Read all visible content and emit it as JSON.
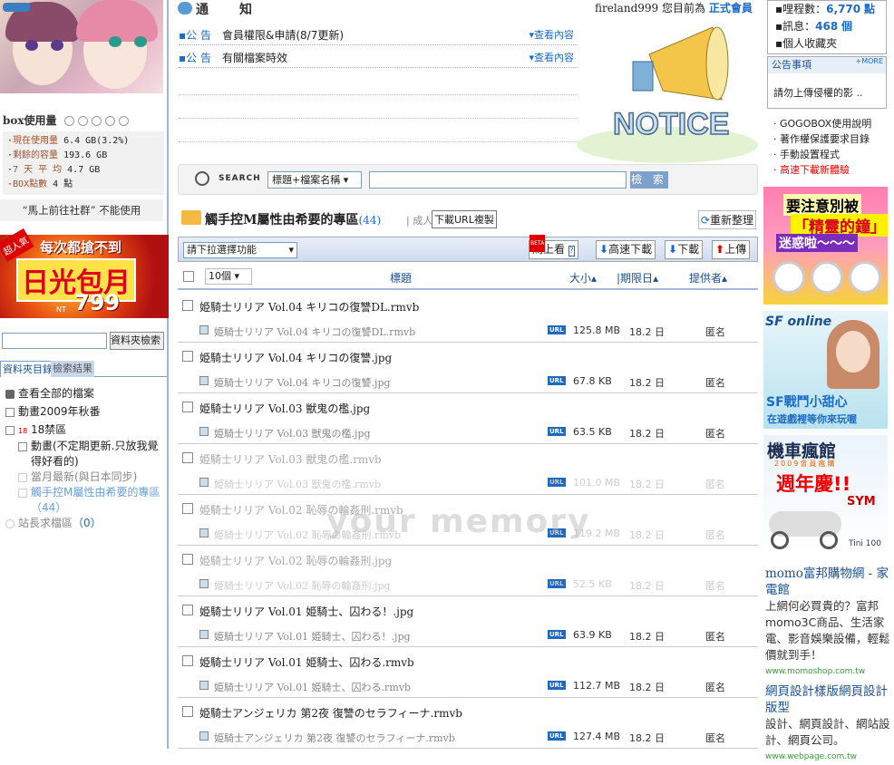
{
  "left": {
    "box_title": "box使用量",
    "box_stats": [
      {
        "k": "現在使用量",
        "v": "6.4 GB(3.2%)"
      },
      {
        "k": "剩餘的容量",
        "v": "193.6 GB"
      },
      {
        "k": "7 天 平 均",
        "v": "4.7 GB"
      },
      {
        "k": "BOX點數",
        "v": "4 點"
      }
    ],
    "go_community": "“馬上前往社群” 不能使用",
    "ad": {
      "tag": "超人氣",
      "line1": "每次都搶不到",
      "line2": "日光包月",
      "price": "799",
      "nt": "NT"
    },
    "folder_search_button": "資料夾檢索",
    "tabs": {
      "folders": "資料夾目錄",
      "results": "檢索結果"
    },
    "tree": {
      "all": "查看全部的檔案",
      "anime2009": "動畫2009年秋番",
      "r18": "18禁區",
      "anime_irregular": "動畫(不定期更新.只放我覺得好看的)",
      "monthly": "當月最新(與日本同步)",
      "zone": "觸手控M屬性由希要的專區",
      "zone_count": "（44）",
      "request": "站長求檔區",
      "request_count": "（0）"
    }
  },
  "notice": {
    "title": "通　知",
    "items": [
      {
        "tag": "公 告",
        "text": "會員權限&申請(8/7更新)",
        "more": "查看內容"
      },
      {
        "tag": "公 告",
        "text": "有關檔案時效",
        "more": "查看內容"
      }
    ],
    "user": "fireland999",
    "user_suffix": "您目前為",
    "level": "正式會員",
    "image_text": "NOTICE"
  },
  "search": {
    "label": "SEARCH",
    "select": "標題+檔案名稱",
    "button": "檢 索"
  },
  "zone": {
    "title": "觸手控M屬性由希要的專區",
    "count": "(44)",
    "adult": "成人",
    "url_button": "下載URL複製",
    "reorg": "重新整理"
  },
  "toolbar": {
    "dropdown": "請下拉選擇功能",
    "beta": "BETA",
    "watch": "馬上看",
    "fast": "高速下載",
    "download": "下載",
    "upload": "上傳"
  },
  "columns": {
    "count": "10個",
    "title": "標題",
    "size": "大小",
    "expiry": "期限日",
    "provider": "提供者"
  },
  "files": [
    {
      "name": "姫騎士リリア Vol.04 キリコの復讐DL.rmvb",
      "sub": "姫騎士リリア Vol.04 キリコの復讐DL.rmvb",
      "size": "125.8 MB",
      "days": "18.2 日",
      "prov": "匿名",
      "dim": false
    },
    {
      "name": "姫騎士リリア Vol.04 キリコの復讐.jpg",
      "sub": "姫騎士リリア Vol.04 キリコの復讐.jpg",
      "size": "67.8 KB",
      "days": "18.2 日",
      "prov": "匿名",
      "dim": false
    },
    {
      "name": "姫騎士リリア Vol.03 獣鬼の檻.jpg",
      "sub": "姫騎士リリア Vol.03 獣鬼の檻.jpg",
      "size": "63.5 KB",
      "days": "18.2 日",
      "prov": "匿名",
      "dim": false
    },
    {
      "name": "姫騎士リリア Vol.03 獣鬼の檻.rmvb",
      "sub": "姫騎士リリア Vol.03 獣鬼の檻.rmvb",
      "size": "101.0 MB",
      "days": "18.2 日",
      "prov": "匿名",
      "dim": true
    },
    {
      "name": "姫騎士リリア Vol.02 恥辱の輪姦刑.rmvb",
      "sub": "姫騎士リリア Vol.02 恥辱の輪姦刑.rmvb",
      "size": "119.2 MB",
      "days": "18.2 日",
      "prov": "匿名",
      "dim": true
    },
    {
      "name": "姫騎士リリア Vol.02 恥辱の輪姦刑.jpg",
      "sub": "姫騎士リリア Vol.02 恥辱の輪姦刑.jpg",
      "size": "52.5 KB",
      "days": "18.2 日",
      "prov": "匿名",
      "dim": true
    },
    {
      "name": "姫騎士リリア Vol.01 姫騎士、囚わる！.jpg",
      "sub": "姫騎士リリア Vol.01 姫騎士、囚わる！.jpg",
      "size": "63.9 KB",
      "days": "18.2 日",
      "prov": "匿名",
      "dim": false
    },
    {
      "name": "姫騎士リリア Vol.01 姫騎士、囚わる.rmvb",
      "sub": "姫騎士リリア Vol.01 姫騎士、囚わる.rmvb",
      "size": "112.7 MB",
      "days": "18.2 日",
      "prov": "匿名",
      "dim": false
    },
    {
      "name": "姫騎士アンジェリカ 第2夜 復讐のセラフィーナ.rmvb",
      "sub": "姫騎士アンジェリカ 第2夜 復讐のセラフィーナ.rmvb",
      "size": "127.4 MB",
      "days": "18.2 日",
      "prov": "匿名",
      "dim": false
    }
  ],
  "url_badge": "URL",
  "right": {
    "miles_label": "哩程數：",
    "miles": "6,770",
    "miles_unit": "點",
    "msg_label": "訊息：",
    "msg": "468",
    "msg_unit": "個",
    "fav": "個人收藏夾",
    "notice_head": "公告事項",
    "notice_more": "+MORE",
    "notice_text": "請勿上傳侵權的影 ..",
    "links": [
      "GOGOBOX使用說明",
      "著作權保護要求目錄",
      "手動設置程式",
      "高速下載新體驗"
    ],
    "ad1": [
      "要注意別被",
      "「精靈的鐘」",
      "迷惑啦～～～"
    ],
    "ad2": [
      "SF online",
      "SF戰鬥小甜心",
      "在遊戲裡等你來玩喔"
    ],
    "ad3": [
      "機車瘋館",
      "2009會員瘋購",
      "週年慶!!",
      "SYM",
      "Tini 100"
    ],
    "txt_ads": [
      {
        "t": "momo富邦購物網 - 家電館",
        "d": "上網何必買貴的？富邦momo3C商品、生活家電、影音娛樂設備，輕鬆價就到手！",
        "u": "www.momoshop.com.tw"
      },
      {
        "t": "網頁設計樣版網頁設計版型",
        "d": "設計、網頁設計、網站設計、網頁公司。",
        "u": "www.webpage.com.tw"
      }
    ]
  },
  "watermark": "your memory",
  "colors": {
    "link": "#1b6bc4",
    "accent": "#e00"
  }
}
